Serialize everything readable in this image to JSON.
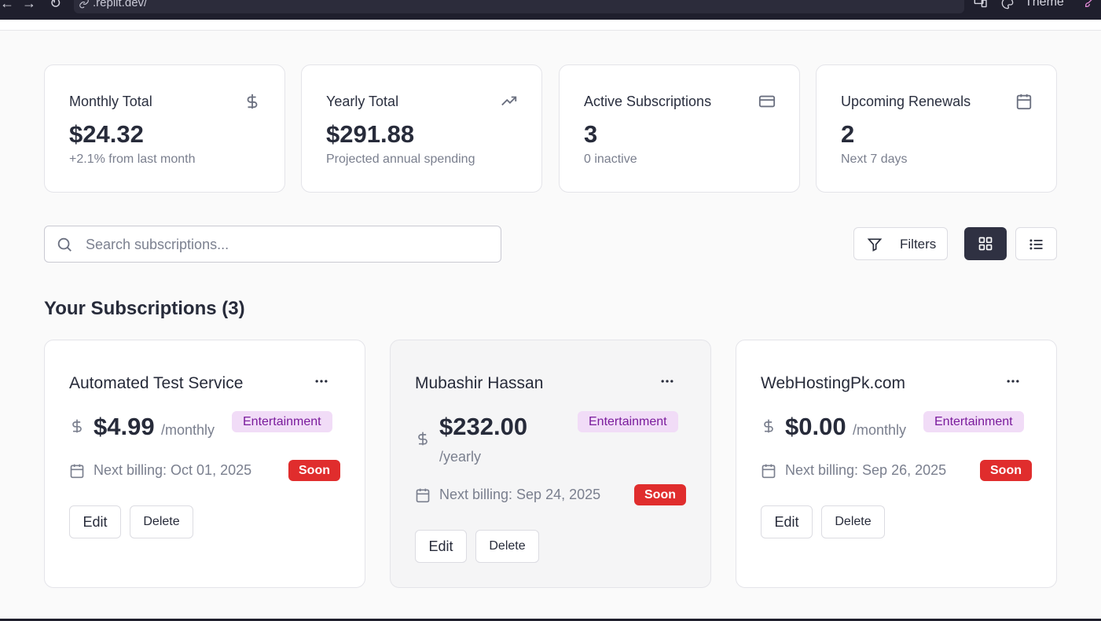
{
  "browser": {
    "url": ".replit.dev/",
    "theme_label": "Theme"
  },
  "stats": [
    {
      "label": "Monthly Total",
      "value": "$24.32",
      "sub": "+2.1% from last month",
      "icon": "dollar-icon"
    },
    {
      "label": "Yearly Total",
      "value": "$291.88",
      "sub": "Projected annual spending",
      "icon": "trending-up-icon"
    },
    {
      "label": "Active Subscriptions",
      "value": "3",
      "sub": "0 inactive",
      "icon": "credit-card-icon"
    },
    {
      "label": "Upcoming Renewals",
      "value": "2",
      "sub": "Next 7 days",
      "icon": "calendar-icon"
    }
  ],
  "toolbar": {
    "search_placeholder": "Search subscriptions...",
    "filters_label": "Filters",
    "view_mode": "grid"
  },
  "section_title": "Your Subscriptions (3)",
  "subscriptions": [
    {
      "name": "Automated Test Service",
      "price": "$4.99",
      "period": "/monthly",
      "category": "Entertainment",
      "next_billing": "Next billing: Oct 01, 2025",
      "status": "Soon",
      "edit_label": "Edit",
      "delete_label": "Delete"
    },
    {
      "name": "Mubashir Hassan",
      "price": "$232.00",
      "period": "/yearly",
      "category": "Entertainment",
      "next_billing": "Next billing: Sep 24, 2025",
      "status": "Soon",
      "edit_label": "Edit",
      "delete_label": "Delete"
    },
    {
      "name": "WebHostingPk.com",
      "price": "$0.00",
      "period": "/monthly",
      "category": "Entertainment",
      "next_billing": "Next billing: Sep 26, 2025",
      "status": "Soon",
      "edit_label": "Edit",
      "delete_label": "Delete"
    }
  ],
  "colors": {
    "category_badge_bg": "#f1dcf7",
    "category_badge_text": "#7a1b9c",
    "soon_badge": "#e02d2d",
    "active_view_button": "#2f3142"
  }
}
